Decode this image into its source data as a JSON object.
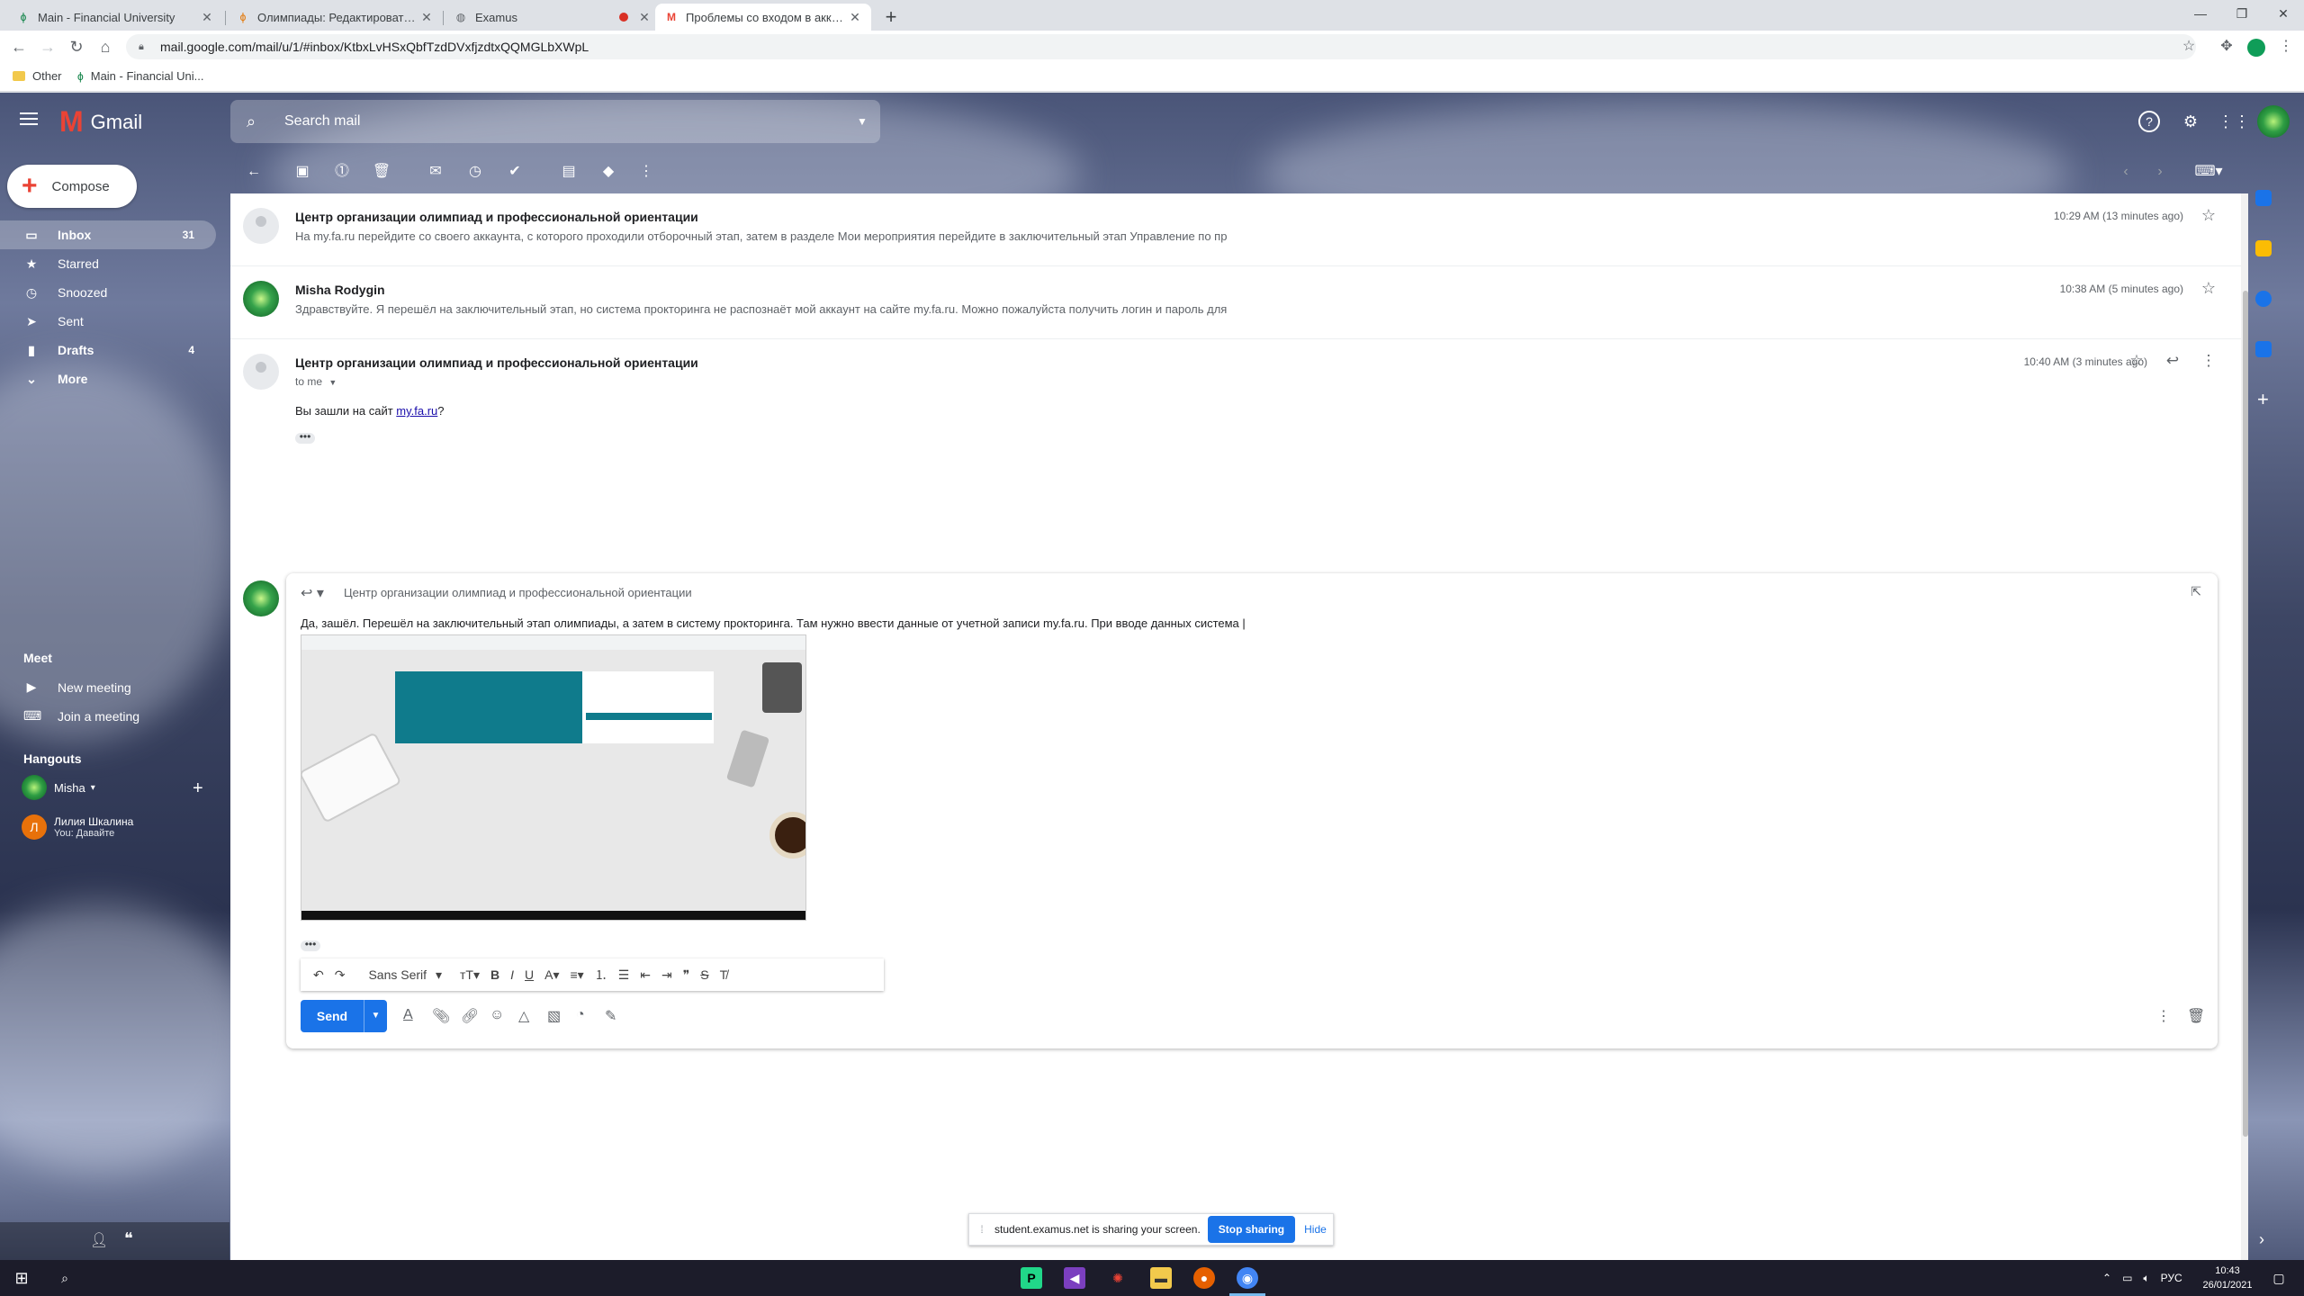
{
  "browser": {
    "tabs": [
      {
        "title": "Main - Financial University",
        "icon": "fu-icon"
      },
      {
        "title": "Олимпиады: Редактировать ин",
        "icon": "fu-icon"
      },
      {
        "title": "Examus",
        "icon": "globe-icon"
      },
      {
        "title": "Проблемы со входом в аккаун",
        "icon": "gmail-icon"
      }
    ],
    "url": "mail.google.com/mail/u/1/#inbox/KtbxLvHSxQbfTzdDVxfjzdtxQQMGLbXWpL",
    "bookmarks": [
      {
        "label": "Other"
      },
      {
        "label": "Main - Financial Uni..."
      }
    ]
  },
  "gmail": {
    "brand": "Gmail",
    "search_placeholder": "Search mail",
    "compose_label": "Compose",
    "nav": [
      {
        "label": "Inbox",
        "count": "31",
        "icon": "inbox-icon"
      },
      {
        "label": "Starred",
        "count": "",
        "icon": "star-icon"
      },
      {
        "label": "Snoozed",
        "count": "",
        "icon": "clock-icon"
      },
      {
        "label": "Sent",
        "count": "",
        "icon": "send-icon"
      },
      {
        "label": "Drafts",
        "count": "4",
        "icon": "draft-icon"
      },
      {
        "label": "More",
        "count": "",
        "icon": "chevron-down-icon"
      }
    ],
    "meet": {
      "title": "Meet",
      "new_meeting": "New meeting",
      "join_meeting": "Join a meeting"
    },
    "hangouts": {
      "title": "Hangouts",
      "user": "Misha",
      "contact_name": "Лилия Шкалина",
      "contact_status": "You: Давайте",
      "contact_initial": "Л"
    },
    "thread": [
      {
        "sender": "Центр организации олимпиад и профессиональной ориентации",
        "snippet": "На my.fa.ru перейдите со своего аккаунта, с которого проходили отборочный этап, затем в разделе Мои мероприятия перейдите в заключительный этап Управление по пр",
        "time": "10:29 AM (13 minutes ago)"
      },
      {
        "sender": "Misha Rodygin",
        "snippet": "Здравствуйте. Я перешёл на заключительный этап, но система прокторинга не распознаёт мой аккаунт на сайте my.fa.ru. Можно пожалуйста получить логин и пароль для",
        "time": "10:38 AM (5 minutes ago)"
      },
      {
        "sender": "Центр организации олимпиад и профессиональной ориентации",
        "to": "to me",
        "body_prefix": "Вы зашли на сайт ",
        "body_link": "my.fa.ru",
        "body_suffix": "?",
        "time": "10:40 AM (3 minutes ago)"
      }
    ],
    "reply": {
      "to": "Центр организации олимпиад и профессиональной ориентации",
      "text": "Да, зашёл. Перешёл на заключительный этап олимпиады, а затем в систему прокторинга. Там нужно ввести данные от учетной записи my.fa.ru. При вводе данных система |",
      "font": "Sans Serif",
      "send_label": "Send"
    }
  },
  "share_notice": {
    "text": "student.examus.net is sharing your screen.",
    "stop": "Stop sharing",
    "hide": "Hide"
  },
  "taskbar": {
    "time": "10:43",
    "date": "26/01/2021",
    "lang": "РУС"
  }
}
